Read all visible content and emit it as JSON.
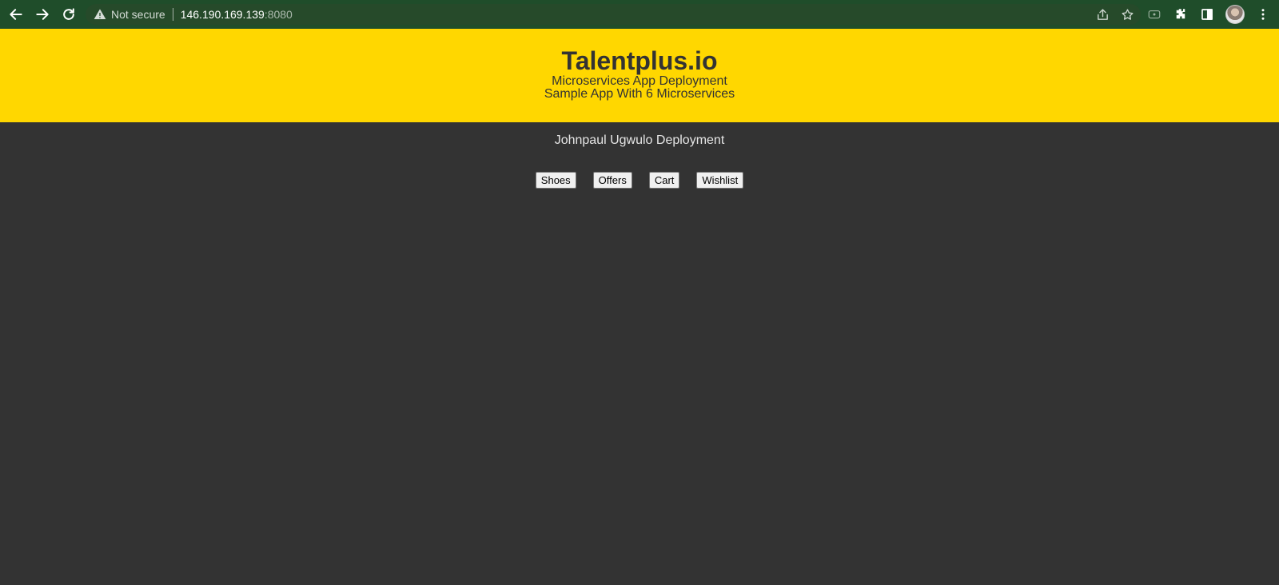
{
  "browser": {
    "security_label": "Not secure",
    "url_host": "146.190.169.139",
    "url_port": ":8080"
  },
  "header": {
    "title": "Talentplus.io",
    "subtitle_line1": "Microservices App Deployment",
    "subtitle_line2": "Sample App With 6 Microservices",
    "background_color": "#ffd700"
  },
  "main": {
    "deployment_title": "Johnpaul Ugwulo Deployment",
    "buttons": [
      "Shoes",
      "Offers",
      "Cart",
      "Wishlist"
    ],
    "background_color": "#333333"
  }
}
